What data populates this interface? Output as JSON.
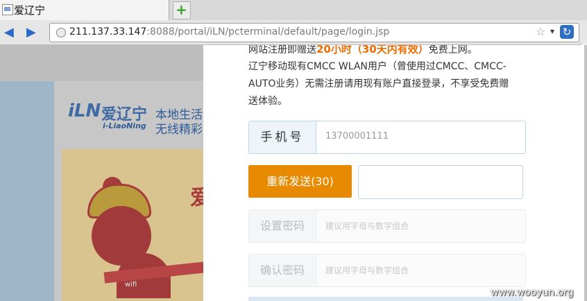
{
  "browser": {
    "tab_title": "爱辽宁",
    "new_tab_glyph": "+",
    "url_host": "211.137.33.147",
    "url_rest": ":8088/portal/iLN/pcterminal/default/page/login.jsp",
    "back_glyph": "◀",
    "forward_glyph": "▶",
    "star_glyph": "☆",
    "dropdown_glyph": "▾",
    "reload_glyph": "↻"
  },
  "background_page": {
    "logo_mark": "iLN",
    "logo_cn": "爱辽宁",
    "logo_en": "i-LiaoNing",
    "tagline_1": "本地生活",
    "tagline_2": "无线精彩",
    "hero_text": "爱",
    "wifi_badge": "wifi"
  },
  "modal": {
    "promo_prefix": "网站注册即赠送",
    "promo_highlight": "20小时（30天内有效）",
    "promo_suffix": "免费上网。",
    "notice": "辽宁移动现有CMCC WLAN用户（曾使用过CMCC、CMCC-AUTO业务）无需注册请用现有账户直接登录，不享受免费赠送体验。",
    "phone_label": "手机号",
    "phone_value": "13700001111",
    "resend_button": "重新发送(30)",
    "verification_code_value": "",
    "password_label": "设置密码",
    "password_placeholder": "建议用字母与数字组合",
    "confirm_label": "确认密码",
    "confirm_placeholder": "建议用字母与数字组合"
  },
  "watermark": "www.wooyun.org",
  "colors": {
    "accent_orange": "#e88a00",
    "highlight_text": "#ef6c00",
    "field_border": "#b9d6ea"
  }
}
